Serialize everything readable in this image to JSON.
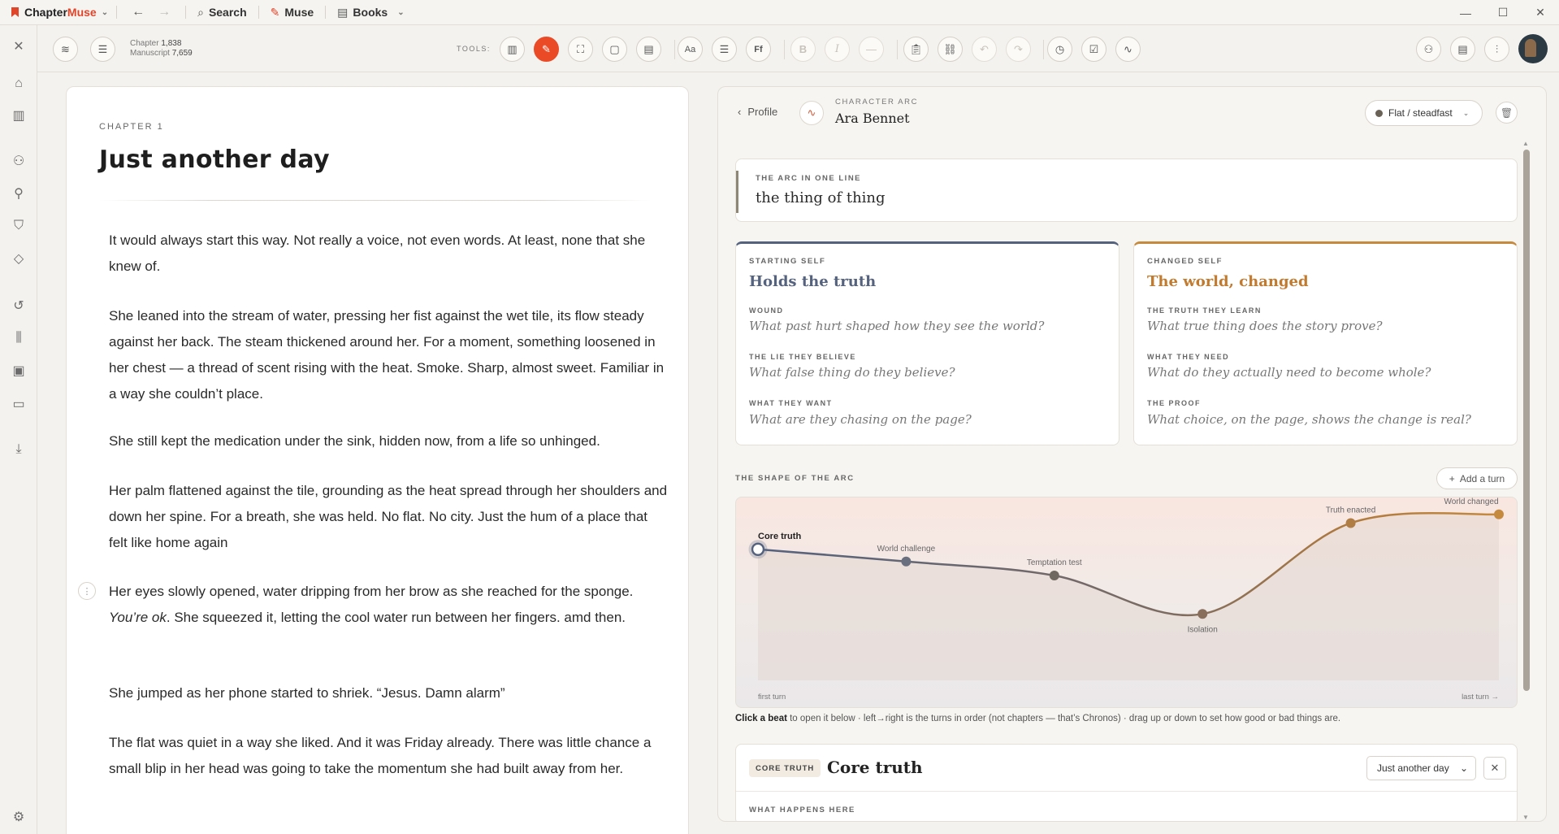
{
  "app": {
    "brand_a": "Chapter",
    "brand_b": "Muse",
    "search": "Search",
    "muse": "Muse",
    "books": "Books"
  },
  "toolbar": {
    "chapter_label": "Chapter",
    "chapter_count": "1,838",
    "manuscript_label": "Manuscript",
    "manuscript_count": "7,659",
    "tools_label": "TOOLS:",
    "font_btn": "Aa",
    "ff_btn": "Ff",
    "bold_btn": "B",
    "italic_btn": "I"
  },
  "manuscript": {
    "chapter_label": "CHAPTER 1",
    "title": "Just another day",
    "paragraphs": [
      "It would always start this way. Not really a voice, not even words. At least, none that she knew of.",
      "She leaned into the stream of water, pressing her fist against the wet tile, its flow steady against her back. The steam thickened around her. For a moment, something loosened in her chest — a thread of scent rising with the heat. Smoke. Sharp, almost sweet. Familiar in a way she couldn’t place.",
      "She still kept the medication under the sink, hidden now, from a life so unhinged.",
      "Her palm flattened against the tile, grounding as the heat spread through her shoulders and down her spine. For a breath, she was held. No flat. No city. Just the hum of a place that felt like home again",
      "Her eyes slowly opened, water dripping from her brow as she reached for the sponge. ",
      "She jumped as her phone started to shriek. “Jesus. Damn alarm”",
      "The flat was quiet in a way she liked. And it was Friday already. There was little chance a small blip in her head was going to take the momentum she had built away from her."
    ],
    "p5_italic": "You’re ok",
    "p5_rest": ". She squeezed it, letting the cool water run between her fingers. amd then."
  },
  "panel": {
    "back_label": "Profile",
    "section_label": "CHARACTER ARC",
    "character_name": "Ara Bennet",
    "arc_type": "Flat / steadfast",
    "oneline_label": "THE ARC IN ONE LINE",
    "oneline_value": "the thing of thing",
    "starting": {
      "label": "STARTING SELF",
      "head": "Holds the truth",
      "fields": [
        {
          "label": "WOUND",
          "q": "What past hurt shaped how they see the world?"
        },
        {
          "label": "THE LIE THEY BELIEVE",
          "q": "What false thing do they believe?"
        },
        {
          "label": "WHAT THEY WANT",
          "q": "What are they chasing on the page?"
        }
      ]
    },
    "changed": {
      "label": "CHANGED SELF",
      "head": "The world, changed",
      "fields": [
        {
          "label": "THE TRUTH THEY LEARN",
          "q": "What true thing does the story prove?"
        },
        {
          "label": "WHAT THEY NEED",
          "q": "What do they actually need to become whole?"
        },
        {
          "label": "THE PROOF",
          "q": "What choice, on the page, shows the change is real?"
        }
      ]
    },
    "shape_label": "THE SHAPE OF THE ARC",
    "add_turn": "Add a turn",
    "first_turn": "first turn",
    "last_turn": "last turn →",
    "hint_bold": "Click a beat",
    "hint_rest": " to open it below · left→right is the turns in order (not chapters — that’s Chronos) · drag up or down to set how good or bad things are.",
    "beat": {
      "tag": "CORE TRUTH",
      "title": "Core truth",
      "chapter": "Just another day",
      "what_label": "WHAT HAPPENS HERE"
    }
  },
  "colors": {
    "accent": "#ea4a25",
    "start": "#55627e",
    "changed": "#c17a2e"
  },
  "chart_data": {
    "type": "line",
    "x": [
      "Core truth",
      "World challenge",
      "Temptation test",
      "Isolation",
      "Truth enacted",
      "World changed"
    ],
    "y": [
      0.75,
      0.68,
      0.6,
      0.38,
      0.9,
      0.95
    ],
    "ylim": [
      0,
      1
    ],
    "xlabel_left": "first turn",
    "xlabel_right": "last turn →"
  }
}
